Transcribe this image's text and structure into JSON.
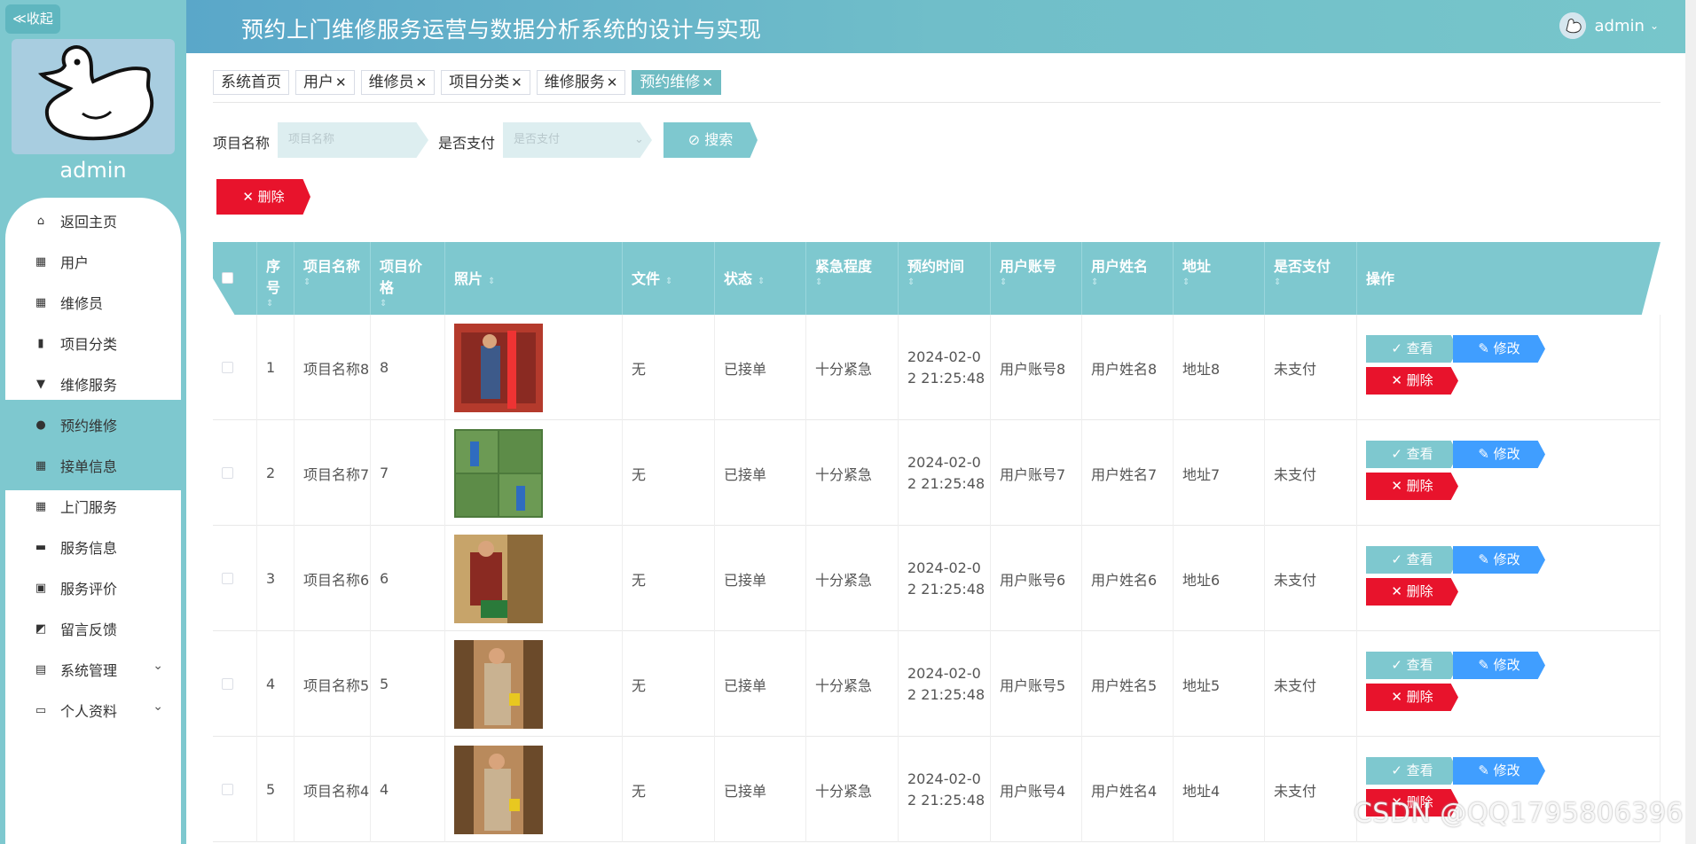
{
  "sidebar": {
    "collapse_label": "≪收起",
    "username": "admin",
    "items": [
      {
        "label": "返回主页",
        "icon": "home-icon",
        "glyph": "⌂"
      },
      {
        "label": "用户",
        "icon": "grid-icon",
        "glyph": "▦"
      },
      {
        "label": "维修员",
        "icon": "grid-icon",
        "glyph": "▦"
      },
      {
        "label": "项目分类",
        "icon": "chart-icon",
        "glyph": "▮"
      },
      {
        "label": "维修服务",
        "icon": "pin-icon",
        "glyph": "▼"
      },
      {
        "label": "预约维修",
        "icon": "person-icon",
        "glyph": "●"
      },
      {
        "label": "接单信息",
        "icon": "grid-icon",
        "glyph": "▦"
      },
      {
        "label": "上门服务",
        "icon": "grid-icon",
        "glyph": "▦"
      },
      {
        "label": "服务信息",
        "icon": "briefcase-icon",
        "glyph": "▬"
      },
      {
        "label": "服务评价",
        "icon": "clipboard-icon",
        "glyph": "▣"
      },
      {
        "label": "留言反馈",
        "icon": "chart-icon",
        "glyph": "◩"
      },
      {
        "label": "系统管理",
        "icon": "clipboard-icon",
        "glyph": "▤"
      },
      {
        "label": "个人资料",
        "icon": "card-icon",
        "glyph": "▭"
      }
    ]
  },
  "header": {
    "title": "预约上门维修服务运营与数据分析系统的设计与实现",
    "user": "admin"
  },
  "tabs": [
    "系统首页",
    "用户",
    "维修员",
    "项目分类",
    "维修服务",
    "预约维修"
  ],
  "search": {
    "name_label": "项目名称",
    "name_placeholder": "项目名称",
    "paid_label": "是否支付",
    "paid_placeholder": "是否支付",
    "search_btn": "搜索",
    "delete_btn": "删除"
  },
  "table": {
    "headers": [
      "序号",
      "项目名称",
      "项目价格",
      "照片",
      "文件",
      "状态",
      "紧急程度",
      "预约时间",
      "用户账号",
      "用户姓名",
      "地址",
      "是否支付",
      "操作"
    ],
    "view_label": "查看",
    "edit_label": "修改",
    "delete_label": "删除",
    "rows": [
      {
        "idx": "1",
        "name": "项目名称8",
        "price": "8",
        "file": "无",
        "status": "已接单",
        "urgency": "十分紧急",
        "time1": "2024-02-0",
        "time2": "2 21:25:48",
        "account": "用户账号8",
        "uname": "用户姓名8",
        "addr": "地址8",
        "paid": "未支付"
      },
      {
        "idx": "2",
        "name": "项目名称7",
        "price": "7",
        "file": "无",
        "status": "已接单",
        "urgency": "十分紧急",
        "time1": "2024-02-0",
        "time2": "2 21:25:48",
        "account": "用户账号7",
        "uname": "用户姓名7",
        "addr": "地址7",
        "paid": "未支付"
      },
      {
        "idx": "3",
        "name": "项目名称6",
        "price": "6",
        "file": "无",
        "status": "已接单",
        "urgency": "十分紧急",
        "time1": "2024-02-0",
        "time2": "2 21:25:48",
        "account": "用户账号6",
        "uname": "用户姓名6",
        "addr": "地址6",
        "paid": "未支付"
      },
      {
        "idx": "4",
        "name": "项目名称5",
        "price": "5",
        "file": "无",
        "status": "已接单",
        "urgency": "十分紧急",
        "time1": "2024-02-0",
        "time2": "2 21:25:48",
        "account": "用户账号5",
        "uname": "用户姓名5",
        "addr": "地址5",
        "paid": "未支付"
      },
      {
        "idx": "5",
        "name": "项目名称4",
        "price": "4",
        "file": "无",
        "status": "已接单",
        "urgency": "十分紧急",
        "time1": "2024-02-0",
        "time2": "2 21:25:48",
        "account": "用户账号4",
        "uname": "用户姓名4",
        "addr": "地址4",
        "paid": "未支付"
      }
    ]
  },
  "watermark": "CSDN @QQ1795806396",
  "colors": {
    "accent": "#7ec8cf",
    "danger": "#e8132c",
    "primary": "#409eff"
  }
}
